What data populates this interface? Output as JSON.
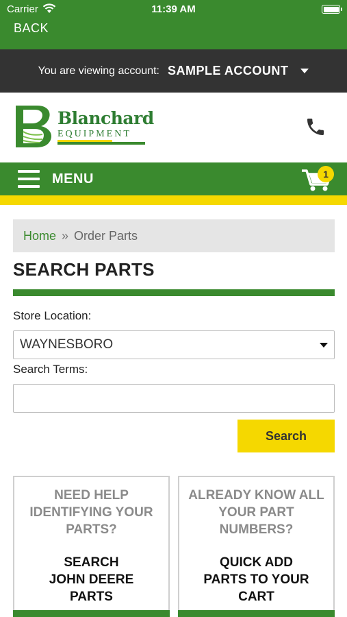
{
  "status_bar": {
    "carrier": "Carrier",
    "time": "11:39 AM"
  },
  "nav": {
    "back_label": "BACK"
  },
  "account_bar": {
    "label": "You are viewing account:",
    "account_name": "SAMPLE ACCOUNT"
  },
  "logo": {
    "name": "Blanchard",
    "subname": "EQUIPMENT",
    "initial": "B"
  },
  "menu_bar": {
    "menu_label": "MENU",
    "cart_count": "1"
  },
  "breadcrumb": {
    "home": "Home",
    "separator": "»",
    "current": "Order Parts"
  },
  "search_form": {
    "title": "SEARCH PARTS",
    "store_label": "Store Location:",
    "store_value": "WAYNESBORO",
    "terms_label": "Search Terms:",
    "terms_value": "",
    "search_button": "Search"
  },
  "cards": [
    {
      "question_lines": [
        "NEED HELP",
        "IDENTIFYING YOUR",
        "PARTS?"
      ],
      "action_lines": [
        "SEARCH",
        "JOHN DEERE",
        "PARTS"
      ]
    },
    {
      "question_lines": [
        "ALREADY KNOW ALL",
        "YOUR PART",
        "NUMBERS?"
      ],
      "action_lines": [
        "QUICK ADD",
        "PARTS TO YOUR",
        "CART"
      ]
    }
  ],
  "colors": {
    "primary_green": "#3a8a2e",
    "accent_yellow": "#f5d800",
    "account_bar": "#333333",
    "breadcrumb_bg": "#e5e5e5"
  },
  "icons": [
    "wifi-icon",
    "battery-icon",
    "phone-icon",
    "hamburger-icon",
    "cart-icon",
    "dropdown-caret-icon"
  ]
}
